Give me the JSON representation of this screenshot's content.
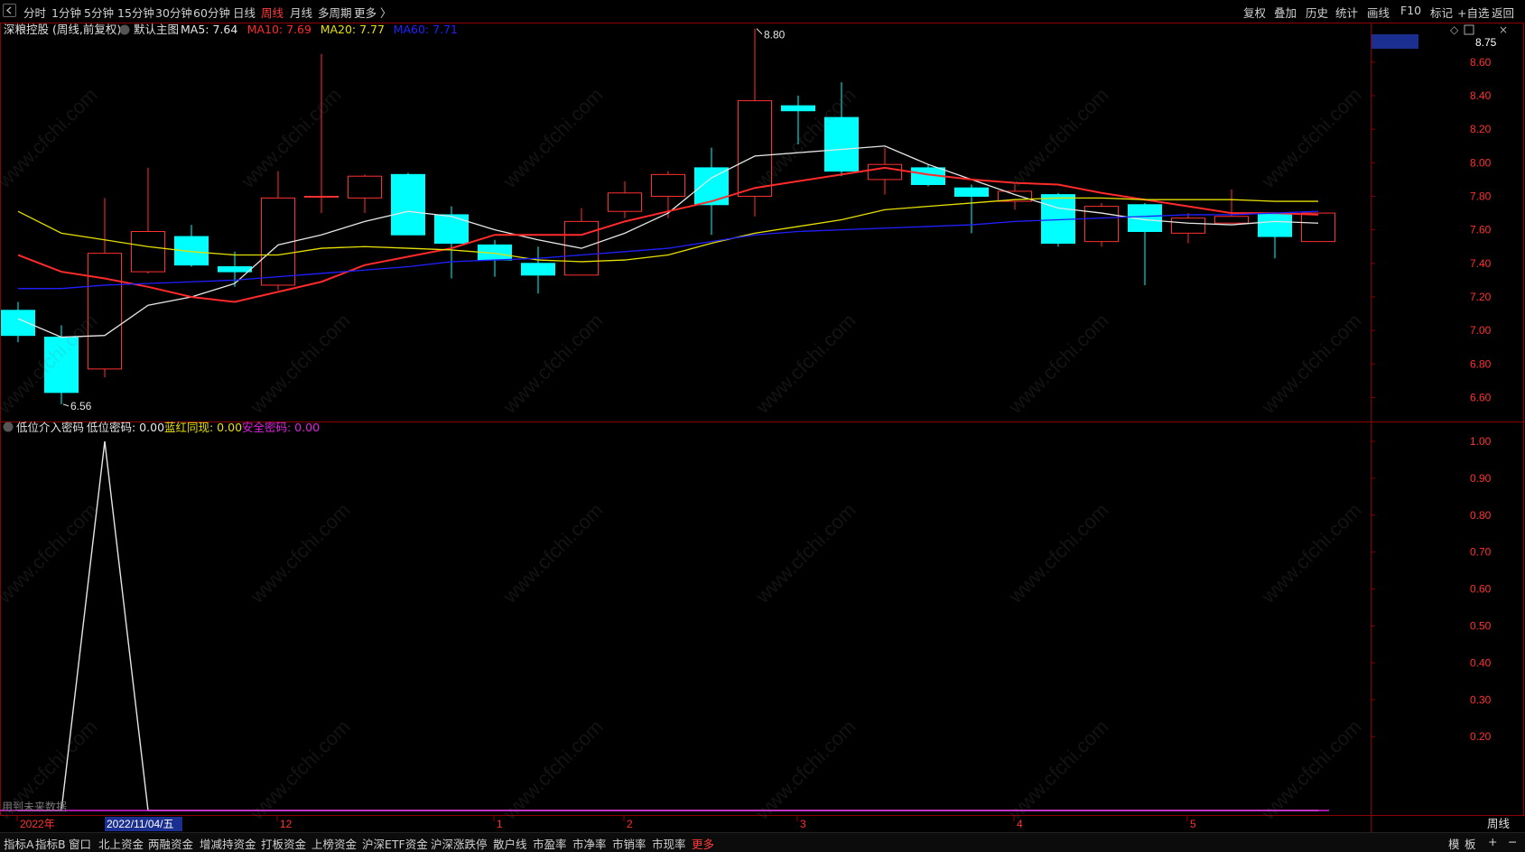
{
  "toolbar": {
    "corner_icon": "chevron-left-icon",
    "periods": [
      "分时",
      "1分钟",
      "5分钟",
      "15分钟",
      "30分钟",
      "60分钟",
      "日线",
      "周线",
      "月线",
      "多周期",
      "更多 〉"
    ],
    "active_period": "周线",
    "right_tools": [
      "复权",
      "叠加",
      "历史",
      "统计",
      "画线",
      "F10",
      "标记",
      "+自选",
      "返回"
    ]
  },
  "main_header": {
    "stock": "深粮控股 (周线,前复权)",
    "template": "默认主图",
    "ma": [
      {
        "label": "MA5: 7.64",
        "color": "#e6e6e6"
      },
      {
        "label": "MA10: 7.69",
        "color": "#ff2a2a"
      },
      {
        "label": "MA20: 7.77",
        "color": "#e6e000"
      },
      {
        "label": "MA60: 7.71",
        "color": "#2020ff"
      }
    ],
    "current_price_tag": "8.75"
  },
  "sub_header": {
    "name": "低位介入密码",
    "items": [
      {
        "label": "低位密码: 0.00",
        "color": "#e6e6e6"
      },
      {
        "label": "蓝红同现: 0.00",
        "color": "#e6e000"
      },
      {
        "label": "安全密码: 0.00",
        "color": "#e020e0"
      }
    ],
    "note": "用到未来数据"
  },
  "period_label": "周线",
  "x_axis": {
    "cursor_date": "2022/11/04/五",
    "labels": [
      {
        "text": "2022年",
        "i": 0
      },
      {
        "text": "12",
        "i": 6
      },
      {
        "text": "1",
        "i": 11
      },
      {
        "text": "2",
        "i": 14
      },
      {
        "text": "3",
        "i": 18
      },
      {
        "text": "4",
        "i": 23
      },
      {
        "text": "5",
        "i": 27
      }
    ]
  },
  "watermark": "www.cfchi.com",
  "bottom_tabs": [
    "指标A",
    "指标B",
    "窗口",
    "北上资金",
    "两融资金",
    "增减持资金",
    "打板资金",
    "上榜资金",
    "沪深ETF资金",
    "沪深涨跌停",
    "散户线",
    "市盈率",
    "市净率",
    "市销率",
    "市现率",
    "更多"
  ],
  "bottom_right": [
    "模",
    "板",
    "+",
    "−"
  ],
  "chart_data": [
    {
      "type": "candlestick",
      "title": "深粮控股 (周线,前复权)",
      "ylim": [
        6.5,
        8.75
      ],
      "yticks": [
        6.6,
        6.8,
        7.0,
        7.2,
        7.4,
        7.6,
        7.8,
        8.0,
        8.2,
        8.4,
        8.6
      ],
      "candles": [
        {
          "o": 7.12,
          "h": 7.17,
          "l": 6.93,
          "c": 6.97
        },
        {
          "o": 6.96,
          "h": 7.03,
          "l": 6.56,
          "c": 6.63
        },
        {
          "o": 6.77,
          "h": 7.79,
          "l": 6.72,
          "c": 7.46
        },
        {
          "o": 7.35,
          "h": 7.97,
          "l": 7.34,
          "c": 7.59
        },
        {
          "o": 7.56,
          "h": 7.63,
          "l": 7.38,
          "c": 7.39
        },
        {
          "o": 7.38,
          "h": 7.47,
          "l": 7.26,
          "c": 7.35
        },
        {
          "o": 7.27,
          "h": 7.95,
          "l": 7.24,
          "c": 7.79
        },
        {
          "o": 7.8,
          "h": 8.65,
          "l": 7.7,
          "c": 7.8
        },
        {
          "o": 7.79,
          "h": 7.93,
          "l": 7.7,
          "c": 7.92
        },
        {
          "o": 7.93,
          "h": 7.94,
          "l": 7.57,
          "c": 7.57
        },
        {
          "o": 7.69,
          "h": 7.74,
          "l": 7.31,
          "c": 7.52
        },
        {
          "o": 7.51,
          "h": 7.54,
          "l": 7.32,
          "c": 7.42
        },
        {
          "o": 7.4,
          "h": 7.5,
          "l": 7.22,
          "c": 7.33
        },
        {
          "o": 7.33,
          "h": 7.73,
          "l": 7.33,
          "c": 7.65
        },
        {
          "o": 7.71,
          "h": 7.89,
          "l": 7.67,
          "c": 7.82
        },
        {
          "o": 7.8,
          "h": 7.95,
          "l": 7.67,
          "c": 7.93
        },
        {
          "o": 7.97,
          "h": 8.09,
          "l": 7.57,
          "c": 7.75
        },
        {
          "o": 7.8,
          "h": 8.8,
          "l": 7.68,
          "c": 8.37
        },
        {
          "o": 8.34,
          "h": 8.4,
          "l": 8.11,
          "c": 8.31
        },
        {
          "o": 8.27,
          "h": 8.48,
          "l": 7.92,
          "c": 7.95
        },
        {
          "o": 7.9,
          "h": 8.09,
          "l": 7.81,
          "c": 7.99
        },
        {
          "o": 7.97,
          "h": 7.99,
          "l": 7.86,
          "c": 7.87
        },
        {
          "o": 7.85,
          "h": 7.87,
          "l": 7.58,
          "c": 7.8
        },
        {
          "o": 7.77,
          "h": 7.87,
          "l": 7.72,
          "c": 7.83
        },
        {
          "o": 7.81,
          "h": 7.82,
          "l": 7.5,
          "c": 7.52
        },
        {
          "o": 7.53,
          "h": 7.76,
          "l": 7.5,
          "c": 7.74
        },
        {
          "o": 7.75,
          "h": 7.76,
          "l": 7.27,
          "c": 7.59
        },
        {
          "o": 7.58,
          "h": 7.7,
          "l": 7.52,
          "c": 7.67
        },
        {
          "o": 7.64,
          "h": 7.84,
          "l": 7.64,
          "c": 7.68
        },
        {
          "o": 7.7,
          "h": 7.7,
          "l": 7.43,
          "c": 7.56
        },
        {
          "o": 7.53,
          "h": 7.7,
          "l": 7.53,
          "c": 7.7
        }
      ],
      "ma_lines": [
        {
          "name": "MA5",
          "color": "#e6e6e6",
          "values": [
            7.07,
            6.96,
            6.97,
            7.15,
            7.2,
            7.28,
            7.51,
            7.57,
            7.65,
            7.71,
            7.68,
            7.6,
            7.54,
            7.49,
            7.58,
            7.7,
            7.91,
            8.04,
            8.06,
            8.08,
            8.1,
            7.99,
            7.9,
            7.81,
            7.73,
            7.7,
            7.66,
            7.64,
            7.63,
            7.65,
            7.64
          ]
        },
        {
          "name": "MA10",
          "color": "#ff2a2a",
          "values": [
            7.45,
            7.35,
            7.31,
            7.26,
            7.2,
            7.17,
            7.23,
            7.29,
            7.39,
            7.44,
            7.49,
            7.57,
            7.57,
            7.57,
            7.65,
            7.71,
            7.77,
            7.85,
            7.89,
            7.93,
            7.97,
            7.93,
            7.9,
            7.88,
            7.87,
            7.82,
            7.78,
            7.74,
            7.7,
            7.7,
            7.69
          ]
        },
        {
          "name": "MA20",
          "color": "#e6e000",
          "values": [
            7.71,
            7.58,
            7.54,
            7.5,
            7.47,
            7.45,
            7.45,
            7.49,
            7.5,
            7.49,
            7.48,
            7.46,
            7.42,
            7.41,
            7.42,
            7.45,
            7.52,
            7.58,
            7.62,
            7.66,
            7.72,
            7.74,
            7.76,
            7.78,
            7.79,
            7.79,
            7.78,
            7.78,
            7.78,
            7.77,
            7.77
          ]
        },
        {
          "name": "MA60",
          "color": "#2020ff",
          "values": [
            7.25,
            7.25,
            7.27,
            7.28,
            7.29,
            7.3,
            7.32,
            7.34,
            7.36,
            7.38,
            7.41,
            7.42,
            7.43,
            7.45,
            7.47,
            7.49,
            7.53,
            7.57,
            7.59,
            7.6,
            7.61,
            7.62,
            7.63,
            7.65,
            7.66,
            7.67,
            7.68,
            7.69,
            7.69,
            7.7,
            7.71
          ]
        }
      ],
      "annotations": [
        {
          "text": "8.80",
          "i": 17,
          "y": 8.8,
          "kind": "high"
        },
        {
          "text": "6.56",
          "i": 1,
          "y": 6.56,
          "kind": "low"
        }
      ]
    },
    {
      "type": "line",
      "title": "低位介入密码",
      "ylim": [
        0,
        1.05
      ],
      "yticks": [
        0.2,
        0.3,
        0.4,
        0.5,
        0.6,
        0.7,
        0.8,
        0.9,
        1.0
      ],
      "series": [
        {
          "name": "低位密码",
          "color": "#e6e6e6",
          "values": [
            0,
            0,
            1,
            0,
            0,
            0,
            0,
            0,
            0,
            0,
            0,
            0,
            0,
            0,
            0,
            0,
            0,
            0,
            0,
            0,
            0,
            0,
            0,
            0,
            0,
            0,
            0,
            0,
            0,
            0,
            0
          ]
        },
        {
          "name": "安全密码",
          "color": "#e020e0",
          "values": [
            0,
            0,
            0,
            0,
            0,
            0,
            0,
            0,
            0,
            0,
            0,
            0,
            0,
            0,
            0,
            0,
            0,
            0,
            0,
            0,
            0,
            0,
            0,
            0,
            0,
            0,
            0,
            0,
            0,
            0,
            0
          ]
        }
      ]
    }
  ]
}
